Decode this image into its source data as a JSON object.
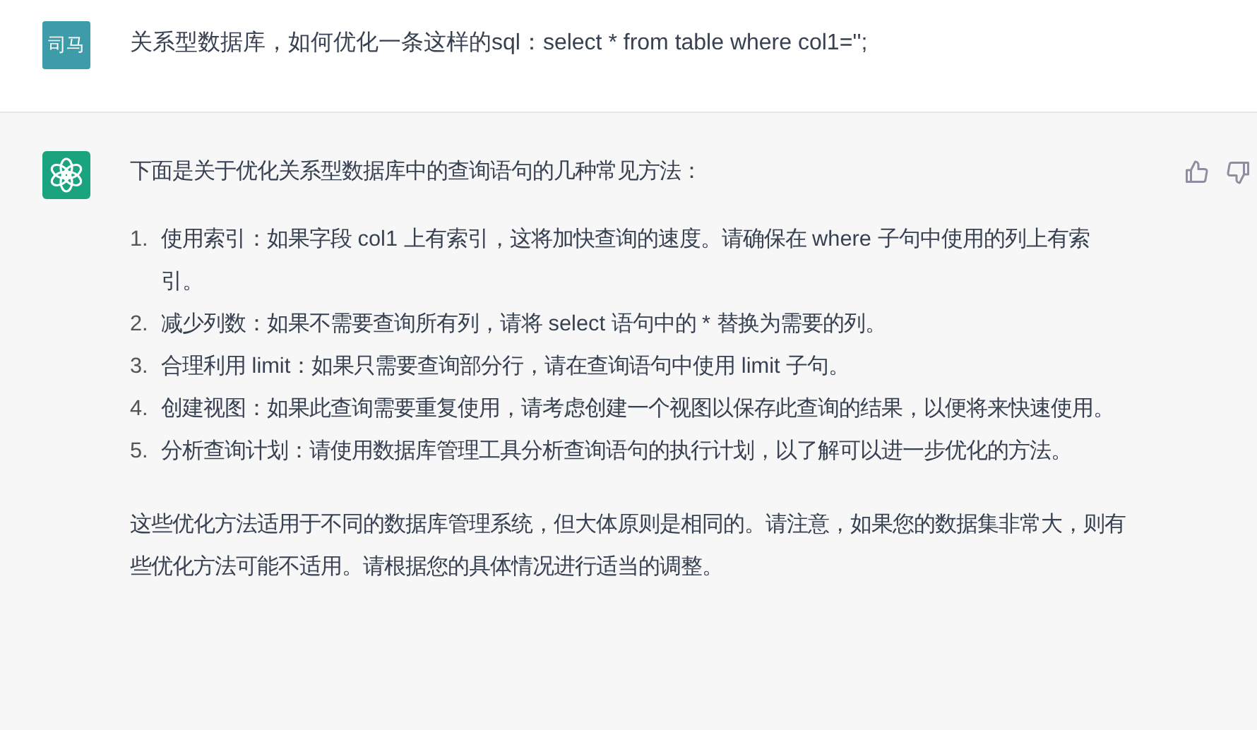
{
  "messages": [
    {
      "kind": "user",
      "avatar": "司马",
      "text": "关系型数据库，如何优化一条这样的sql：select * from table where col1='';"
    },
    {
      "kind": "assistant",
      "intro": "下面是关于优化关系型数据库中的查询语句的几种常见方法：",
      "items": [
        {
          "number": "1.",
          "text": "使用索引：如果字段 col1 上有索引，这将加快查询的速度。请确保在 where 子句中使用的列上有索引。"
        },
        {
          "number": "2.",
          "text": "减少列数：如果不需要查询所有列，请将 select 语句中的 * 替换为需要的列。"
        },
        {
          "number": "3.",
          "text": "合理利用 limit：如果只需要查询部分行，请在查询语句中使用 limit 子句。"
        },
        {
          "number": "4.",
          "text": "创建视图：如果此查询需要重复使用，请考虑创建一个视图以保存此查询的结果，以便将来快速使用。"
        },
        {
          "number": "5.",
          "text": "分析查询计划：请使用数据库管理工具分析查询语句的执行计划，以了解可以进一步优化的方法。"
        }
      ],
      "outro": "这些优化方法适用于不同的数据库管理系统，但大体原则是相同的。请注意，如果您的数据集非常大，则有些优化方法可能不适用。请根据您的具体情况进行适当的调整。"
    }
  ]
}
